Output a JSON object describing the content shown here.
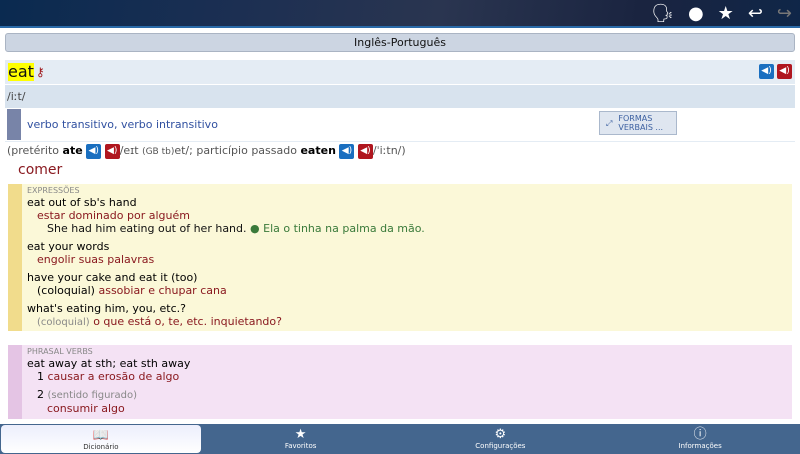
{
  "toolbar": {
    "icons": [
      "speak-icon",
      "circle-icon",
      "add-favorite-icon",
      "back-icon",
      "forward-icon"
    ]
  },
  "dictionary": "Inglês-Português",
  "entry": {
    "headword": "eat",
    "pronunciation": "/iːt/",
    "pos": "verbo transitivo, verbo intransitivo",
    "forms_button": "FORMAS VERBAIS ...",
    "infl": {
      "open": "(pretérito",
      "past": "ate",
      "past_pron": "/eɪt",
      "gb": "(GB tb)",
      "gb_pron": "et/; particípio passado",
      "pp": "eaten",
      "pp_pron": "/ˈiːtn/)"
    },
    "translation": "comer"
  },
  "expressions": {
    "label": "Expressões",
    "items": [
      {
        "phrase": "eat out of sb's hand",
        "trans": "estar dominado por alguém",
        "example": "She had him eating out of her hand.",
        "example_trans": "Ela o tinha na palma da mão."
      },
      {
        "phrase": "eat your words",
        "trans": "engolir suas palavras"
      },
      {
        "phrase": "have your cake and eat it (too)",
        "note": "(coloquial)",
        "trans": "assobiar e chupar cana"
      },
      {
        "phrase": "what's eating him, you, etc.?",
        "note": "(coloquial)",
        "trans": "o que está o, te, etc. inquietando?"
      }
    ]
  },
  "phrasal": {
    "label": "Phrasal verbs",
    "items": [
      {
        "phrase": "eat away at sth; eat sth away",
        "senses": [
          {
            "n": "1",
            "trans": "causar a erosão de algo"
          },
          {
            "n": "2",
            "note": "(sentido figurado)",
            "trans": "consumir algo"
          }
        ]
      }
    ]
  },
  "tabs": [
    "Dicionário",
    "Favoritos",
    "Configurações",
    "Informações"
  ]
}
